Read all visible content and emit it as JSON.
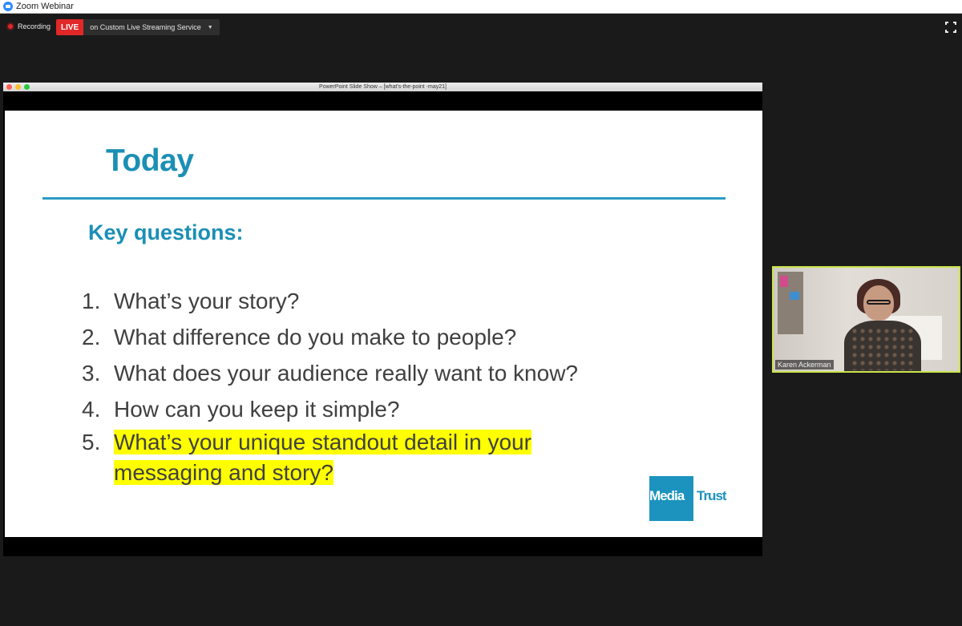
{
  "app": {
    "title": "Zoom Webinar"
  },
  "recording": {
    "label": "Recording"
  },
  "live": {
    "badge": "LIVE",
    "service": "on Custom Live Streaming Service"
  },
  "share_window": {
    "title": "PowerPoint Slide Show – [what's-the-point -may21]"
  },
  "slide": {
    "title": "Today",
    "subtitle": "Key questions:",
    "questions": [
      {
        "num": "1.",
        "text": "What’s your story?"
      },
      {
        "num": "2.",
        "text": "What difference do you make to people?"
      },
      {
        "num": "3.",
        "text": "What does your audience really want to know?"
      },
      {
        "num": "4.",
        "text": "How can you keep it simple?"
      },
      {
        "num": "5.",
        "text_line1": "What’s your unique standout detail in your",
        "text_line2": "messaging and story?"
      }
    ],
    "logo": {
      "part1": "Media",
      "part2": "Trust"
    }
  },
  "video": {
    "name": "Karen Ackerman"
  },
  "colors": {
    "accent": "#1b8fb5",
    "live": "#e02828",
    "highlight": "#ffff00",
    "speaker_border": "#c9e34a"
  }
}
